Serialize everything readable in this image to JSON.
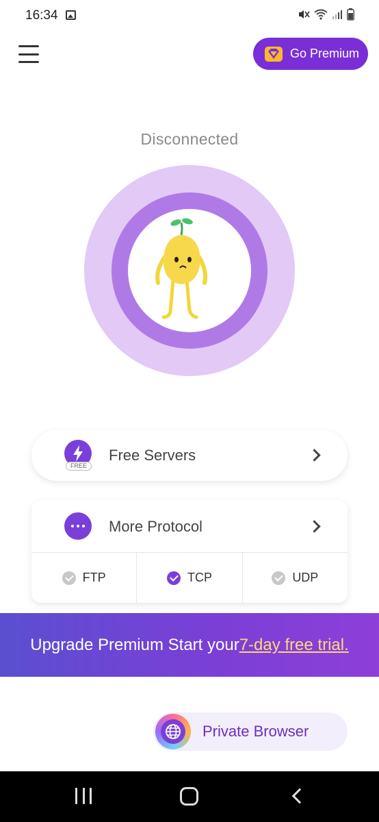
{
  "status_bar": {
    "time": "16:34",
    "icons": [
      "image-icon",
      "mute-icon",
      "wifi-icon",
      "signal-icon",
      "battery-icon"
    ]
  },
  "header": {
    "menu_icon": "hamburger-menu-icon",
    "premium_label": "Go Premium",
    "premium_icon": "diamond-icon"
  },
  "connection": {
    "status": "Disconnected"
  },
  "servers": {
    "label": "Free Servers",
    "badge": "FREE",
    "icon": "lightning-icon"
  },
  "protocol": {
    "label": "More Protocol",
    "icon": "more-dots-icon",
    "options": [
      {
        "label": "FTP",
        "selected": false
      },
      {
        "label": "TCP",
        "selected": true
      },
      {
        "label": "UDP",
        "selected": false
      }
    ]
  },
  "banner": {
    "text": "Upgrade Premium Start your ",
    "link": "7-day free trial."
  },
  "private_browser": {
    "label": "Private Browser",
    "icon": "globe-icon"
  },
  "colors": {
    "primary": "#7b3fd9",
    "ring_outer": "#e2c9f6",
    "ring_mid": "#b07ae6",
    "banner_link": "#ffd77a"
  }
}
